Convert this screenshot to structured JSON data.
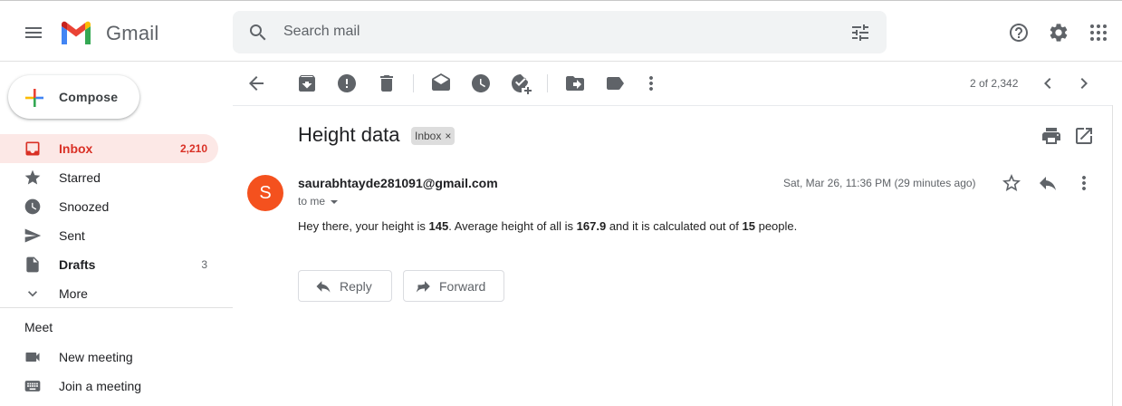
{
  "app": {
    "name": "Gmail"
  },
  "search": {
    "placeholder": "Search mail"
  },
  "compose": {
    "label": "Compose"
  },
  "sidebar": {
    "items": [
      {
        "label": "Inbox",
        "count": "2,210"
      },
      {
        "label": "Starred",
        "count": ""
      },
      {
        "label": "Snoozed",
        "count": ""
      },
      {
        "label": "Sent",
        "count": ""
      },
      {
        "label": "Drafts",
        "count": "3"
      },
      {
        "label": "More",
        "count": ""
      }
    ],
    "meet": {
      "title": "Meet",
      "items": [
        {
          "label": "New meeting"
        },
        {
          "label": "Join a meeting"
        }
      ]
    }
  },
  "toolbar": {
    "pager": "2 of 2,342"
  },
  "message": {
    "subject": "Height data",
    "label": "Inbox",
    "avatar_letter": "S",
    "sender": "saurabhtayde281091@gmail.com",
    "to": "to me",
    "date": "Sat, Mar 26, 11:36 PM (29 minutes ago)",
    "body": {
      "p1": "Hey there, your height is ",
      "height": "145",
      "p2": ". Average height of all is ",
      "avg": "167.9",
      "p3": " and it is calculated out of ",
      "count": "15",
      "p4": " people."
    },
    "reply_label": "Reply",
    "forward_label": "Forward"
  },
  "colors": {
    "accent_red": "#d93025",
    "active_bg": "#fce8e6",
    "avatar_bg": "#f4511e",
    "search_bg": "#f1f3f4"
  },
  "icons": {
    "header": [
      "menu-icon",
      "gmail-logo",
      "search-icon",
      "tune-icon",
      "help-icon",
      "settings-icon",
      "apps-icon"
    ],
    "toolbar": [
      "back-arrow-icon",
      "archive-icon",
      "report-spam-icon",
      "delete-icon",
      "mark-unread-icon",
      "snooze-icon",
      "add-task-icon",
      "move-to-icon",
      "label-icon",
      "more-vert-icon",
      "prev-icon",
      "next-icon"
    ]
  }
}
